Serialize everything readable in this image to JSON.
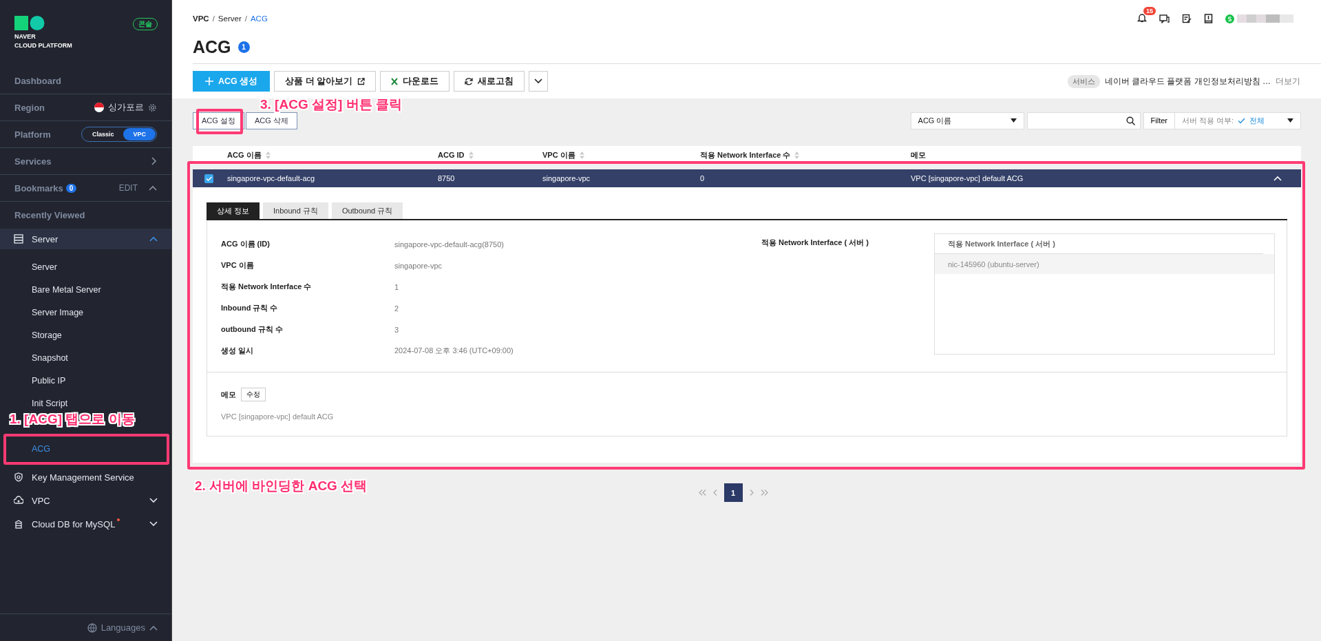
{
  "sidebar": {
    "logo": [
      "NAVER",
      "CLOUD PLATFORM"
    ],
    "console_badge": "콘솔",
    "dashboard": "Dashboard",
    "region": {
      "label": "Region",
      "value": "싱가포르"
    },
    "platform": {
      "label": "Platform",
      "options": [
        {
          "label": "Classic",
          "selected": false
        },
        {
          "label": "VPC",
          "selected": true
        }
      ]
    },
    "services": "Services",
    "bookmarks": {
      "label": "Bookmarks",
      "count": "0",
      "edit": "EDIT",
      "expanded": true
    },
    "recently_viewed": "Recently Viewed",
    "menu": [
      {
        "label": "Server",
        "expanded": true,
        "children": [
          {
            "label": "Server",
            "selected": false
          },
          {
            "label": "Bare Metal Server",
            "selected": false
          },
          {
            "label": "Server Image",
            "selected": false
          },
          {
            "label": "Storage",
            "selected": false
          },
          {
            "label": "Snapshot",
            "selected": false
          },
          {
            "label": "Public IP",
            "selected": false
          },
          {
            "label": "Init Script",
            "selected": false
          },
          {
            "label": "ACG",
            "selected": true,
            "highlighted": true
          }
        ]
      },
      {
        "label": "Key Management Service"
      },
      {
        "label": "VPC",
        "expanded": false
      },
      {
        "label": "Cloud DB for MySQL",
        "expanded": false,
        "new": true
      }
    ],
    "languages": "Languages"
  },
  "breadcrumb": [
    {
      "label": "VPC",
      "current": false,
      "separator": "/"
    },
    {
      "label": "Server",
      "current": false,
      "separator": "/"
    },
    {
      "label": "ACG",
      "current": true
    }
  ],
  "header": {
    "notifications": "15"
  },
  "title": {
    "text": "ACG",
    "count": "1"
  },
  "toolbar": [
    {
      "kind": "primary",
      "label": "ACG 생성"
    },
    {
      "kind": "external",
      "label": "상품 더 알아보기"
    },
    {
      "kind": "excel",
      "label": "다운로드"
    },
    {
      "kind": "refresh",
      "label": "새로고침"
    },
    {
      "kind": "more"
    }
  ],
  "notice": {
    "tag": "서비스",
    "text": "네이버 클라우드 플랫폼 개인정보처리방침 …",
    "more": "더보기"
  },
  "actions": [
    {
      "label": "ACG 설정",
      "highlighted": true
    },
    {
      "label": "ACG 삭제",
      "highlighted": false
    }
  ],
  "search": {
    "field": "ACG 이름"
  },
  "filter": {
    "button": "Filter",
    "label": "서버 적용 여부:",
    "value": "전체"
  },
  "table": {
    "columns": [
      {
        "label": "ACG 이름",
        "sortable": true
      },
      {
        "label": "ACG ID",
        "sortable": true
      },
      {
        "label": "VPC 이름",
        "sortable": true
      },
      {
        "label": "적용 Network Interface 수",
        "sortable": true
      },
      {
        "label": "메모",
        "sortable": false
      }
    ],
    "rows": [
      {
        "checked": true,
        "selected": true,
        "expanded": true,
        "highlighted": true,
        "cells": [
          "singapore-vpc-default-acg",
          "8750",
          "singapore-vpc",
          "0",
          "VPC [singapore-vpc] default ACG"
        ]
      }
    ]
  },
  "detail": {
    "tabs": [
      {
        "label": "상세 정보",
        "selected": true
      },
      {
        "label": "Inbound 규칙",
        "selected": false
      },
      {
        "label": "Outbound 규칙",
        "selected": false
      }
    ],
    "fields": [
      {
        "label": "ACG 이름 (ID)",
        "value": "singapore-vpc-default-acg(8750)"
      },
      {
        "label": "VPC 이름",
        "value": "singapore-vpc"
      },
      {
        "label": "적용 Network Interface 수",
        "value": "1"
      },
      {
        "label": "Inbound 규칙 수",
        "value": "2"
      },
      {
        "label": "outbound 규칙 수",
        "value": "3"
      },
      {
        "label": "생성 일시",
        "value": "2024-07-08 오후 3:46 (UTC+09:00)"
      }
    ],
    "interfaces": {
      "label": "적용 Network Interface ( 서버 )",
      "header": "적용 Network Interface ( 서버 )",
      "items": [
        "nic-145960 (ubuntu-server)"
      ]
    },
    "memo": {
      "label": "메모",
      "edit": "수정",
      "text": "VPC [singapore-vpc] default ACG"
    }
  },
  "pagination": [
    {
      "label": "1",
      "selected": true
    }
  ],
  "annotations": [
    "1. [ACG] 탭으로 이동",
    "2. 서버에 바인딩한 ACG 선택",
    "3. [ACG 설정] 버튼 클릭"
  ]
}
